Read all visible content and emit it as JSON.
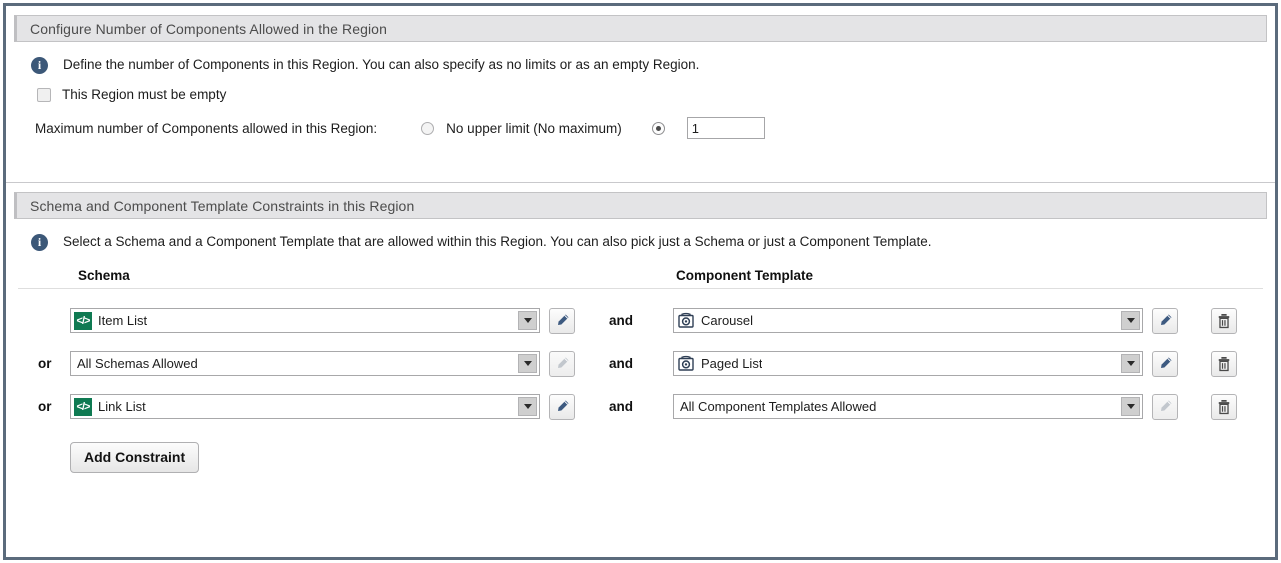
{
  "section_number": {
    "title": "Configure Number of Components Allowed in the Region",
    "info_icon": "info-icon",
    "info_text": "Define the number of Components in this Region. You can also specify as no limits or as an empty Region.",
    "empty_checkbox": {
      "label": "This Region must be empty",
      "checked": false
    },
    "max_label": "Maximum number of Components allowed in this Region:",
    "radio_no_limit": {
      "label": "No upper limit (No maximum)",
      "selected": false
    },
    "radio_value": {
      "selected": true,
      "value": "1"
    }
  },
  "section_constraints": {
    "title": "Schema and Component Template Constraints in this Region",
    "info_icon": "info-icon",
    "info_text": "Select a Schema and a Component Template that are allowed within this Region. You can also pick just a Schema or just a Component Template.",
    "col_schema": "Schema",
    "col_component_template": "Component Template",
    "and_label": "and",
    "or_label": "or",
    "rows": [
      {
        "or": "",
        "schema": {
          "value": "Item List",
          "icon": "schema-code-icon",
          "has_icon": true,
          "edit_enabled": true
        },
        "component_template": {
          "value": "Carousel",
          "icon": "component-template-gear-icon",
          "has_icon": true,
          "edit_enabled": true
        },
        "delete_enabled": true
      },
      {
        "or": "or",
        "schema": {
          "value": "All Schemas Allowed",
          "icon": "",
          "has_icon": false,
          "edit_enabled": false
        },
        "component_template": {
          "value": "Paged List",
          "icon": "component-template-gear-icon",
          "has_icon": true,
          "edit_enabled": true
        },
        "delete_enabled": true
      },
      {
        "or": "or",
        "schema": {
          "value": "Link List",
          "icon": "schema-code-icon",
          "has_icon": true,
          "edit_enabled": true
        },
        "component_template": {
          "value": "All Component Templates Allowed",
          "icon": "",
          "has_icon": false,
          "edit_enabled": false
        },
        "delete_enabled": true
      }
    ],
    "add_constraint_label": "Add Constraint"
  },
  "colors": {
    "frame_border": "#5b6b7c",
    "section_bar_bg": "#e4e4e6",
    "info_icon_bg": "#3c5878",
    "schema_icon_bg": "#0f7a52",
    "pencil_blue": "#3d5a80"
  }
}
